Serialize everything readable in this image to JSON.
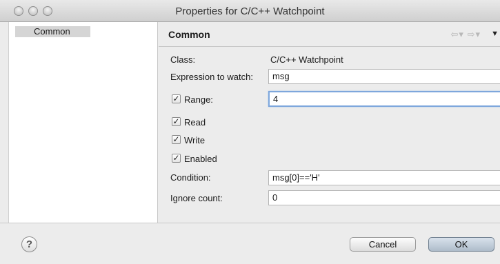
{
  "window": {
    "title": "Properties for C/C++ Watchpoint"
  },
  "sidebar": {
    "items": [
      {
        "label": "Common"
      }
    ]
  },
  "page": {
    "title": "Common"
  },
  "form": {
    "class_label": "Class:",
    "class_value": "C/C++ Watchpoint",
    "expression_label": "Expression to watch:",
    "expression_value": "msg",
    "range_label": "Range:",
    "range_value": "4",
    "read_label": "Read",
    "write_label": "Write",
    "enabled_label": "Enabled",
    "condition_label": "Condition:",
    "condition_value": "msg[0]=='H'",
    "ignore_label": "Ignore count:",
    "ignore_value": "0",
    "checkboxes": {
      "range": true,
      "read": true,
      "write": true,
      "enabled": true
    }
  },
  "buttons": {
    "cancel": "Cancel",
    "ok": "OK",
    "help": "?"
  },
  "icons": {
    "back": "back-arrow-icon",
    "forward": "forward-arrow-icon",
    "view_menu": "view-menu-icon",
    "check": "✓",
    "back_glyph": "⇦▾",
    "forward_glyph": "⇨▾",
    "menu_glyph": "▼"
  }
}
